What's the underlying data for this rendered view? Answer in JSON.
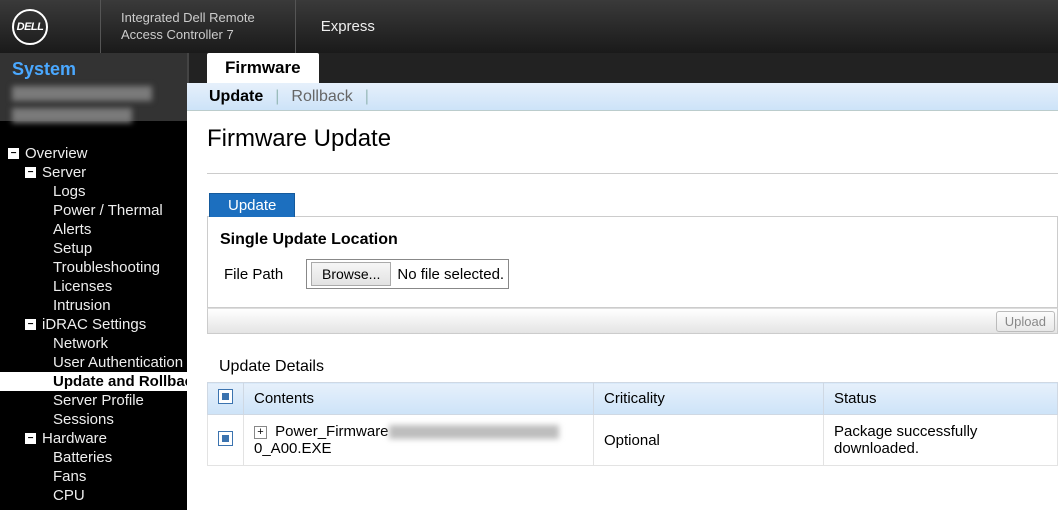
{
  "brand": "DELL",
  "header_title_line1": "Integrated Dell Remote",
  "header_title_line2": "Access Controller 7",
  "header_mode": "Express",
  "sidebar": {
    "title": "System",
    "tree": [
      {
        "label": "Overview",
        "level": 0,
        "expander": "-"
      },
      {
        "label": "Server",
        "level": 1,
        "expander": "-"
      },
      {
        "label": "Logs",
        "level": 2
      },
      {
        "label": "Power / Thermal",
        "level": 2
      },
      {
        "label": "Alerts",
        "level": 2
      },
      {
        "label": "Setup",
        "level": 2
      },
      {
        "label": "Troubleshooting",
        "level": 2
      },
      {
        "label": "Licenses",
        "level": 2
      },
      {
        "label": "Intrusion",
        "level": 2
      },
      {
        "label": "iDRAC Settings",
        "level": 1,
        "expander": "-"
      },
      {
        "label": "Network",
        "level": 2
      },
      {
        "label": "User Authentication",
        "level": 2
      },
      {
        "label": "Update and Rollback",
        "level": 2,
        "selected": true
      },
      {
        "label": "Server Profile",
        "level": 2
      },
      {
        "label": "Sessions",
        "level": 2
      },
      {
        "label": "Hardware",
        "level": 1,
        "expander": "-"
      },
      {
        "label": "Batteries",
        "level": 2
      },
      {
        "label": "Fans",
        "level": 2
      },
      {
        "label": "CPU",
        "level": 2
      }
    ]
  },
  "tabs": {
    "main": "Firmware",
    "sub_active": "Update",
    "sub_inactive": "Rollback"
  },
  "page": {
    "title": "Firmware Update",
    "section_tab": "Update",
    "panel_title": "Single Update Location",
    "file_label": "File Path",
    "browse": "Browse...",
    "file_status": "No file selected.",
    "upload_btn": "Upload",
    "details_title": "Update Details",
    "columns": {
      "contents": "Contents",
      "criticality": "Criticality",
      "status": "Status"
    },
    "row": {
      "filename_prefix": "Power_Firmware",
      "filename_suffix": "0_A00.EXE",
      "criticality": "Optional",
      "status": "Package successfully downloaded."
    }
  }
}
